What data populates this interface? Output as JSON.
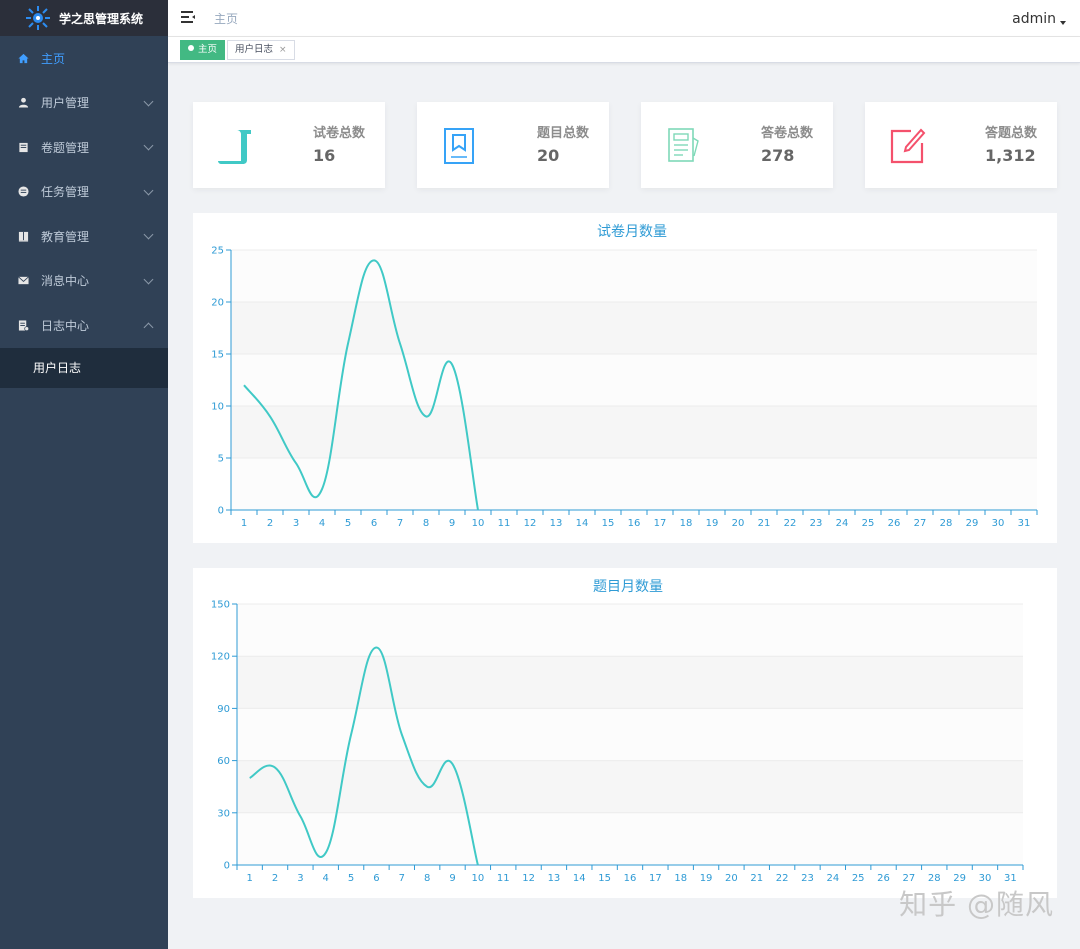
{
  "sidebar": {
    "logo_text": "学之思管理系统",
    "items": [
      {
        "label": "主页",
        "icon": "home-icon",
        "active": true,
        "has_children": false
      },
      {
        "label": "用户管理",
        "icon": "user-icon",
        "active": false,
        "has_children": true
      },
      {
        "label": "卷题管理",
        "icon": "paper-icon",
        "active": false,
        "has_children": true
      },
      {
        "label": "任务管理",
        "icon": "task-icon",
        "active": false,
        "has_children": true
      },
      {
        "label": "教育管理",
        "icon": "book-icon",
        "active": false,
        "has_children": true
      },
      {
        "label": "消息中心",
        "icon": "mail-icon",
        "active": false,
        "has_children": true
      },
      {
        "label": "日志中心",
        "icon": "log-icon",
        "active": false,
        "has_children": true,
        "expanded": true
      }
    ],
    "subitems": [
      {
        "label": "用户日志"
      }
    ]
  },
  "header": {
    "breadcrumb": "主页",
    "user": "admin"
  },
  "tags": [
    {
      "label": "主页",
      "active": true
    },
    {
      "label": "用户日志",
      "active": false,
      "close": "×"
    }
  ],
  "cards": [
    {
      "label": "试卷总数",
      "value": "16",
      "icon": "scroll-icon",
      "color": "#40c9c6"
    },
    {
      "label": "题目总数",
      "value": "20",
      "icon": "bookmark-book-icon",
      "color": "#36a3f7"
    },
    {
      "label": "答卷总数",
      "value": "278",
      "icon": "documents-icon",
      "color": "#7fd9b8"
    },
    {
      "label": "答题总数",
      "value": "1,312",
      "icon": "edit-icon",
      "color": "#f4516c"
    }
  ],
  "chart_data": [
    {
      "type": "line",
      "title": "试卷月数量",
      "x": [
        "1",
        "2",
        "3",
        "4",
        "5",
        "6",
        "7",
        "8",
        "9",
        "10",
        "11",
        "12",
        "13",
        "14",
        "15",
        "16",
        "17",
        "18",
        "19",
        "20",
        "21",
        "22",
        "23",
        "24",
        "25",
        "26",
        "27",
        "28",
        "29",
        "30",
        "31"
      ],
      "series": [
        {
          "values": [
            12,
            9,
            4.5,
            2,
            16,
            24,
            16,
            9,
            14,
            0
          ]
        }
      ],
      "ylim": [
        0,
        25
      ],
      "yticks": [
        0,
        5,
        10,
        15,
        20,
        25
      ],
      "smooth": true,
      "color": "#40c9c6",
      "axis_color": "#2f9bd5"
    },
    {
      "type": "line",
      "title": "题目月数量",
      "x": [
        "1",
        "2",
        "3",
        "4",
        "5",
        "6",
        "7",
        "8",
        "9",
        "10",
        "11",
        "12",
        "13",
        "14",
        "15",
        "16",
        "17",
        "18",
        "19",
        "20",
        "21",
        "22",
        "23",
        "24",
        "25",
        "26",
        "27",
        "28",
        "29",
        "30",
        "31"
      ],
      "series": [
        {
          "values": [
            50,
            56,
            28,
            7,
            75,
            125,
            75,
            45,
            58,
            0
          ]
        }
      ],
      "ylim": [
        0,
        150
      ],
      "yticks": [
        0,
        30,
        60,
        90,
        120,
        150
      ],
      "smooth": true,
      "color": "#40c9c6",
      "axis_color": "#2f9bd5"
    }
  ],
  "watermark": "知乎 @随风"
}
